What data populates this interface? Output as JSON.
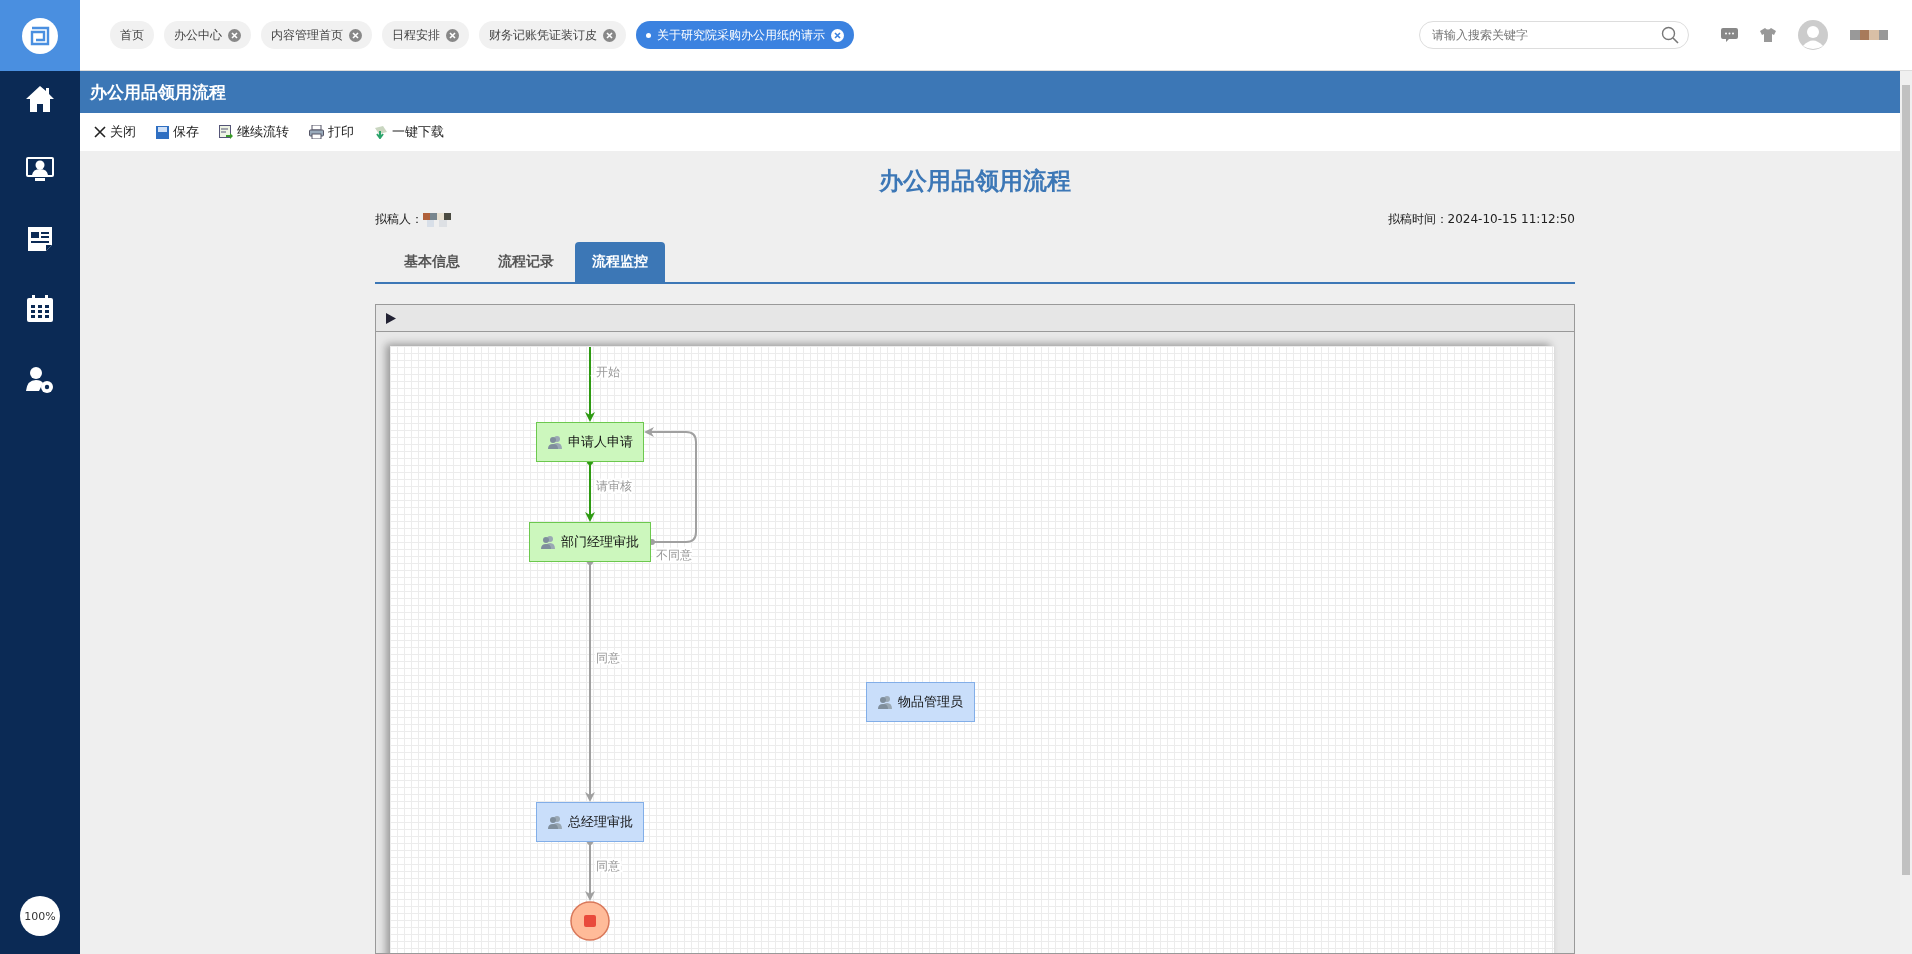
{
  "top_tabs": [
    {
      "label": "首页",
      "closable": false,
      "selected": false
    },
    {
      "label": "办公中心",
      "closable": true,
      "selected": false
    },
    {
      "label": "内容管理首页",
      "closable": true,
      "selected": false
    },
    {
      "label": "日程安排",
      "closable": true,
      "selected": false
    },
    {
      "label": "财务记账凭证装订皮",
      "closable": true,
      "selected": false
    },
    {
      "label": "关于研究院采购办公用纸的请示",
      "closable": true,
      "selected": true
    }
  ],
  "search": {
    "placeholder": "请输入搜索关键字"
  },
  "sidebar": {
    "zoom": "100%"
  },
  "page_title": "办公用品领用流程",
  "toolbar": [
    "关闭",
    "保存",
    "继续流转",
    "打印",
    "一键下载"
  ],
  "document": {
    "title": "办公用品领用流程",
    "author_label": "拟稿人：",
    "time": "拟稿时间：2024-10-15 11:12:50"
  },
  "doc_tabs": [
    {
      "label": "基本信息",
      "selected": false
    },
    {
      "label": "流程记录",
      "selected": false
    },
    {
      "label": "流程监控",
      "selected": true
    }
  ],
  "flow": {
    "nodes": [
      {
        "kind": "task",
        "label": "申请人申请",
        "passed": true
      },
      {
        "kind": "task",
        "label": "部门经理审批",
        "passed": true
      },
      {
        "kind": "task",
        "label": "物品管理员",
        "passed": false
      },
      {
        "kind": "task",
        "label": "总经理审批",
        "passed": false
      },
      {
        "kind": "end"
      }
    ],
    "edges": [
      {
        "label": "开始",
        "passed": true
      },
      {
        "label": "请审核",
        "passed": true
      },
      {
        "label": "不同意",
        "passed": false
      },
      {
        "label": "同意",
        "passed": false
      },
      {
        "label": "同意",
        "passed": false
      }
    ]
  }
}
